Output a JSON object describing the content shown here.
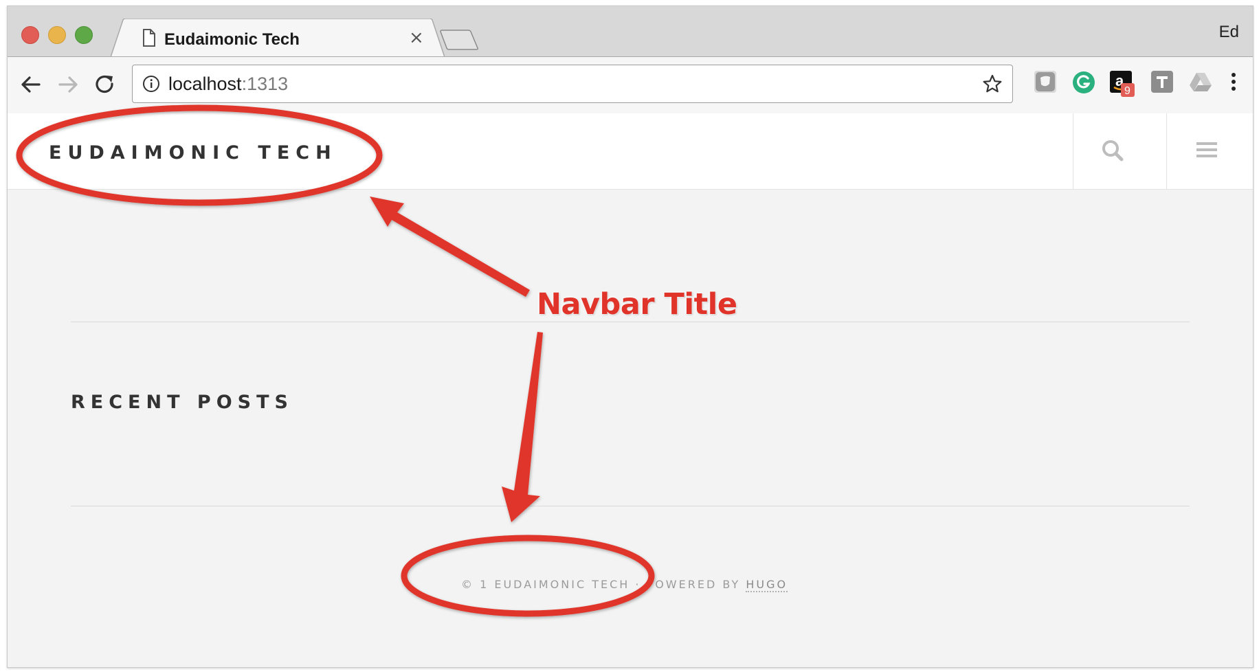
{
  "browser": {
    "tab_title": "Eudaimonic Tech",
    "tab_close": "×",
    "profile_name": "Ed",
    "url_host": "localhost",
    "url_port": ":1313",
    "extension_badge_count": "9"
  },
  "site": {
    "brand": "EUDAIMONIC TECH",
    "section_title": "RECENT POSTS",
    "footer_prefix": "© 1 EUDAIMONIC TECH · POWERED BY ",
    "footer_link": "HUGO"
  },
  "annotation": {
    "label": "Navbar Title",
    "color": "#e0342a"
  },
  "icons": [
    "page-icon",
    "back-arrow-icon",
    "forward-arrow-icon",
    "reload-icon",
    "info-icon",
    "star-icon",
    "grey-extension-icon",
    "grammarly-icon",
    "amazon-icon",
    "t-extension-icon",
    "drive-icon",
    "kebab-menu-icon",
    "search-icon",
    "hamburger-icon"
  ]
}
